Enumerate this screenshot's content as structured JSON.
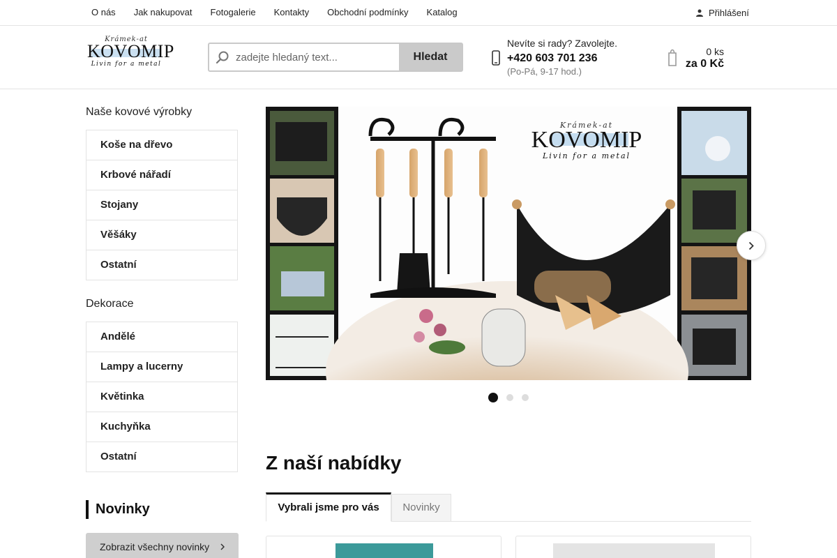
{
  "topnav": {
    "items": [
      "O nás",
      "Jak nakupovat",
      "Fotogalerie",
      "Kontakty",
      "Obchodní podmínky",
      "Katalog"
    ],
    "login_label": "Přihlášení"
  },
  "header": {
    "logo": {
      "top": "Krámek-at",
      "name": "KOVOMIP",
      "tagline": "Livin for a metal"
    },
    "search": {
      "placeholder": "zadejte hledaný text...",
      "button_label": "Hledat"
    },
    "contact": {
      "question": "Nevíte si rady? Zavolejte.",
      "phone": "+420 603 701 236",
      "hours": "(Po-Pá, 9-17 hod.)"
    },
    "cart": {
      "count": "0 ks",
      "price": "za 0 Kč"
    }
  },
  "sidebar": {
    "categories_title": "Naše kovové výrobky",
    "categories": [
      "Koše na dřevo",
      "Krbové nářadí",
      "Stojany",
      "Věšáky",
      "Ostatní"
    ],
    "decor_title": "Dekorace",
    "decor": [
      "Andělé",
      "Lampy a lucerny",
      "Květinka",
      "Kuchyňka",
      "Ostatní"
    ],
    "news_title": "Novinky",
    "news_button": "Zobrazit všechny novinky"
  },
  "banner": {
    "logo_top": "Krámek-at",
    "logo_name": "KOVOMIP",
    "logo_tagline": "Livin for a metal",
    "slides_total": 3,
    "active_slide": 1
  },
  "offer": {
    "title": "Z naší nabídky",
    "tabs": [
      "Vybrali jsme pro vás",
      "Novinky"
    ]
  },
  "colors": {
    "accent": "#111111",
    "border": "#e3e3e3",
    "button_gray": "#cacaca"
  }
}
